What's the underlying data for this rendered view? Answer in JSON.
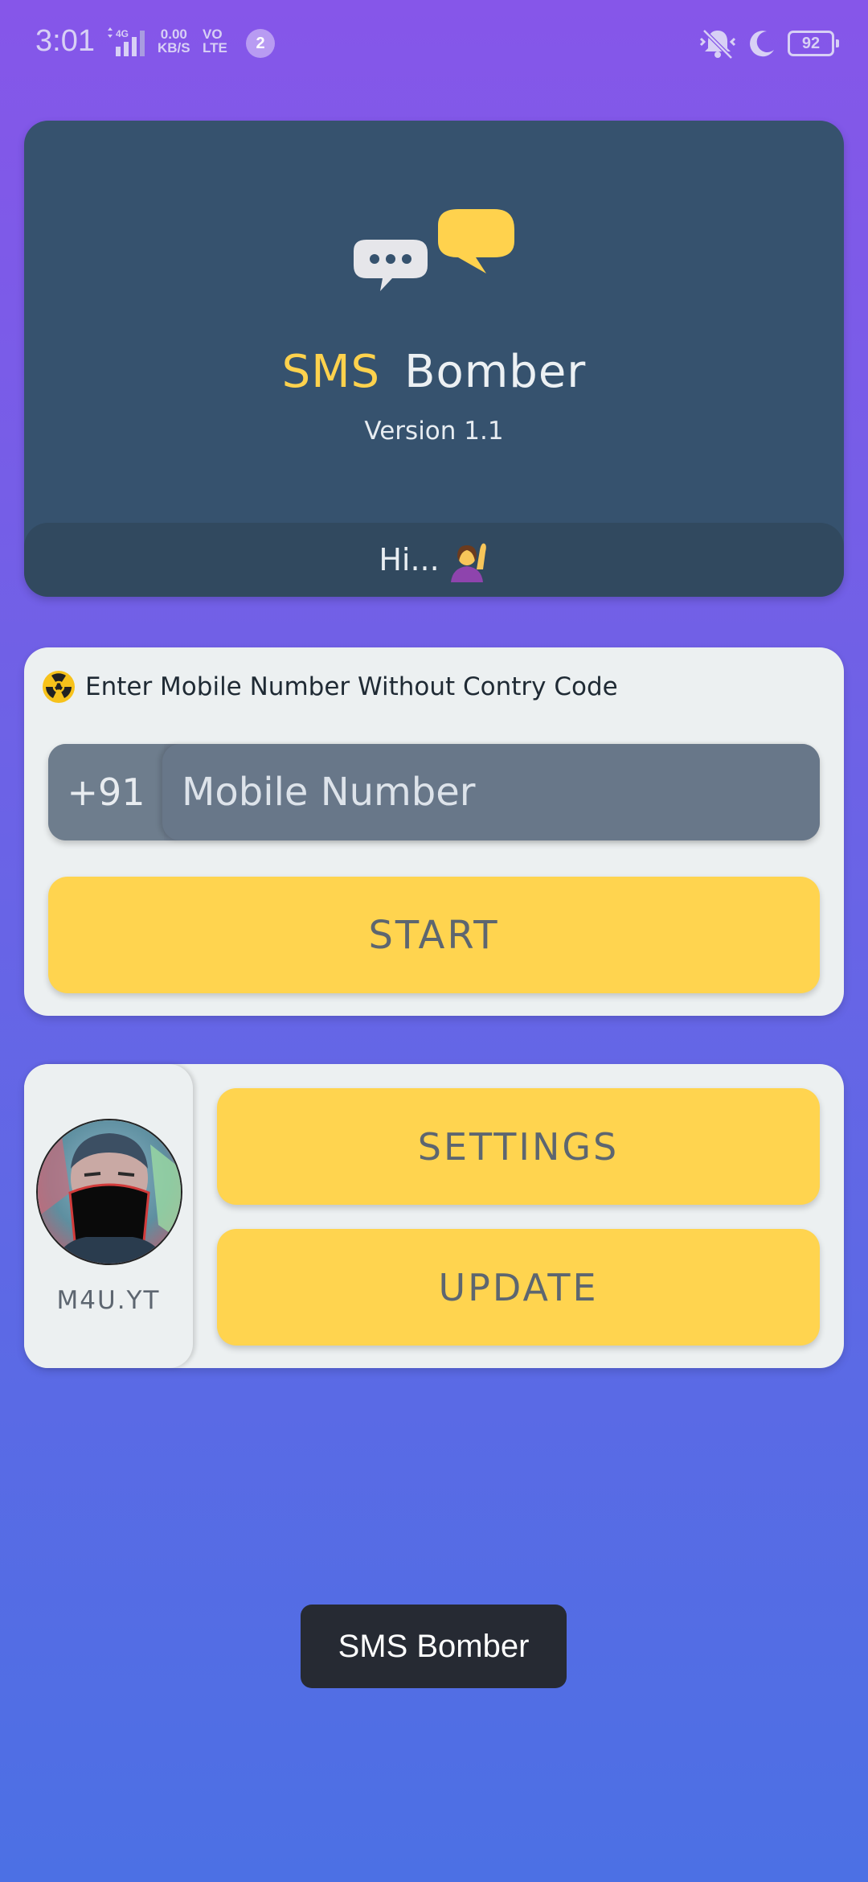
{
  "status_bar": {
    "time": "3:01",
    "network_type": "4G",
    "speed_value": "0.00",
    "speed_unit": "KB/S",
    "volte_top": "VO",
    "volte_bottom": "LTE",
    "notification_count": "2",
    "battery": "92"
  },
  "header": {
    "title_part1": "SMS",
    "title_part2": "Bomber",
    "version": "Version 1.1",
    "greeting": "Hi..."
  },
  "input_card": {
    "hint": "Enter Mobile Number Without Contry Code",
    "country_code": "+91",
    "mobile_placeholder": "Mobile Number",
    "mobile_value": "",
    "start_label": "START"
  },
  "profile_card": {
    "channel_name": "M4U.YT",
    "settings_label": "SETTINGS",
    "update_label": "UPDATE"
  },
  "toast": {
    "message": "SMS Bomber"
  },
  "colors": {
    "accent_yellow": "#ffd44f",
    "card_dark": "#36526e",
    "card_light": "#ecf0f1",
    "gradient_top": "#8656e9",
    "gradient_bottom": "#4c70e4"
  },
  "icons": {
    "logo": "chat-bubbles-icon",
    "greeting": "raising-hand-emoji",
    "hint": "radioactive-icon"
  }
}
